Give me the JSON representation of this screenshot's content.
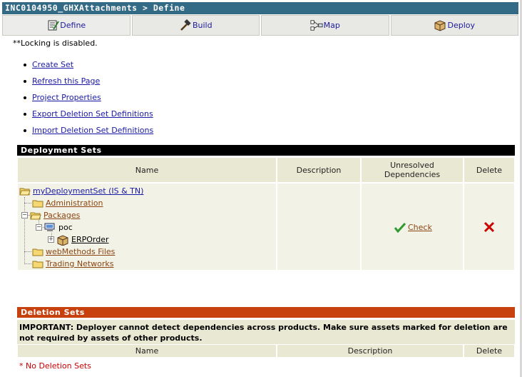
{
  "title": "INC0104950_GHXAttachments > Define",
  "tabs": [
    {
      "label": "Define",
      "icon": "define-icon"
    },
    {
      "label": "Build",
      "icon": "hammer-icon"
    },
    {
      "label": "Map",
      "icon": "map-icon"
    },
    {
      "label": "Deploy",
      "icon": "deploy-box-icon"
    }
  ],
  "notice": "**Locking is disabled.",
  "links": [
    "Create Set",
    "Refresh this Page",
    "Project Properties",
    "Export Deletion Set Definitions",
    "Import Deletion Set Definitions"
  ],
  "deployment_sets": {
    "title": "Deployment Sets",
    "columns": {
      "name": "Name",
      "description": "Description",
      "unresolved": "Unresolved Dependencies",
      "delete": "Delete"
    },
    "tree": {
      "root": "myDeploymentSet (IS & TN)",
      "administration": "Administration",
      "packages": "Packages",
      "server": "poc",
      "package": "ERPOrder",
      "webmethods_files": "webMethods Files",
      "trading_networks": "Trading Networks"
    },
    "check_label": "Check"
  },
  "deletion_sets": {
    "title": "Deletion Sets",
    "important": "IMPORTANT: Deployer cannot detect dependencies across products. Make sure assets marked for deletion are not required by assets of other products.",
    "columns": {
      "name": "Name",
      "description": "Description",
      "delete": "Delete"
    },
    "empty_message": "* No Deletion Sets"
  },
  "colors": {
    "title_bar": "#336a86",
    "section_black": "#000000",
    "section_orange": "#c7410f",
    "header_cell": "#e9e8d3"
  }
}
